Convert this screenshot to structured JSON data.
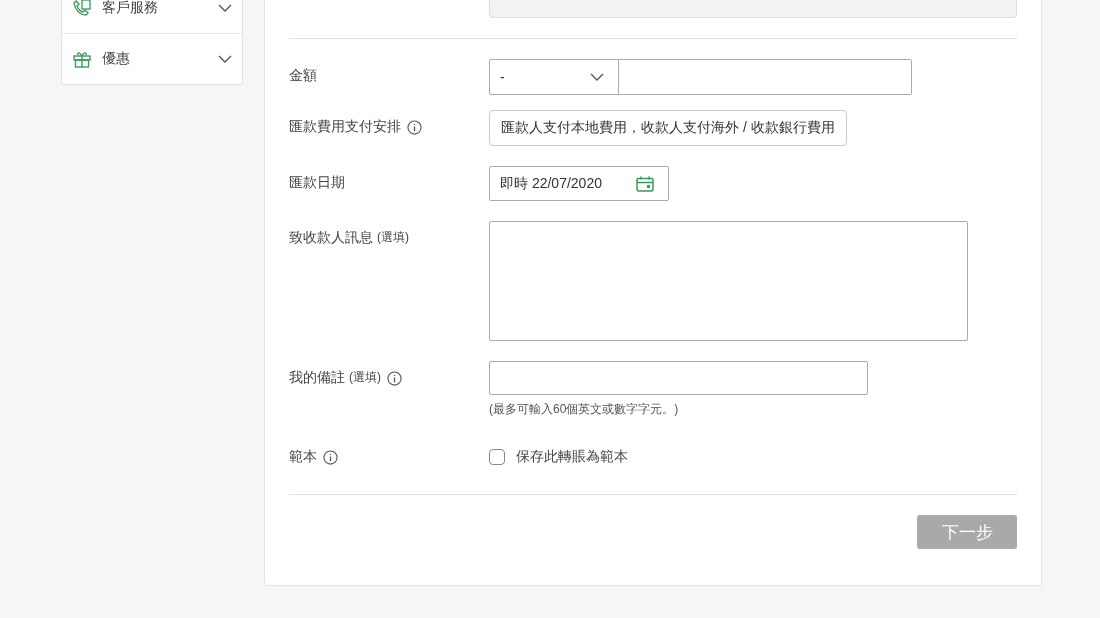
{
  "sidebar": {
    "items": [
      {
        "kind": "service",
        "label": "客戶服務",
        "expanded": false
      },
      {
        "kind": "offer",
        "label": "優惠",
        "expanded": false
      }
    ]
  },
  "form": {
    "rows": [
      {
        "kind": "amount",
        "label": "金額",
        "info": false,
        "currency": "-",
        "value": ""
      },
      {
        "kind": "display",
        "label": "匯款費用支付安排",
        "info": true,
        "value": "匯款人支付本地費用，收款人支付海外 / 收款銀行費用"
      },
      {
        "kind": "date",
        "label": "匯款日期",
        "info": false,
        "value": "即時 22/07/2020"
      },
      {
        "kind": "textarea",
        "label": "致收款人訊息",
        "optional": "(選填)",
        "info": false,
        "value": ""
      },
      {
        "kind": "input",
        "label": "我的備註",
        "optional": "(選填)",
        "info": true,
        "value": "",
        "hint": "(最多可輸入60個英文或數字字元。)"
      },
      {
        "kind": "checkbox",
        "label": "範本",
        "info": true,
        "checked": false,
        "text": "保存此轉賬為範本"
      }
    ],
    "next_button": {
      "label": "下一步",
      "disabled": true
    }
  }
}
